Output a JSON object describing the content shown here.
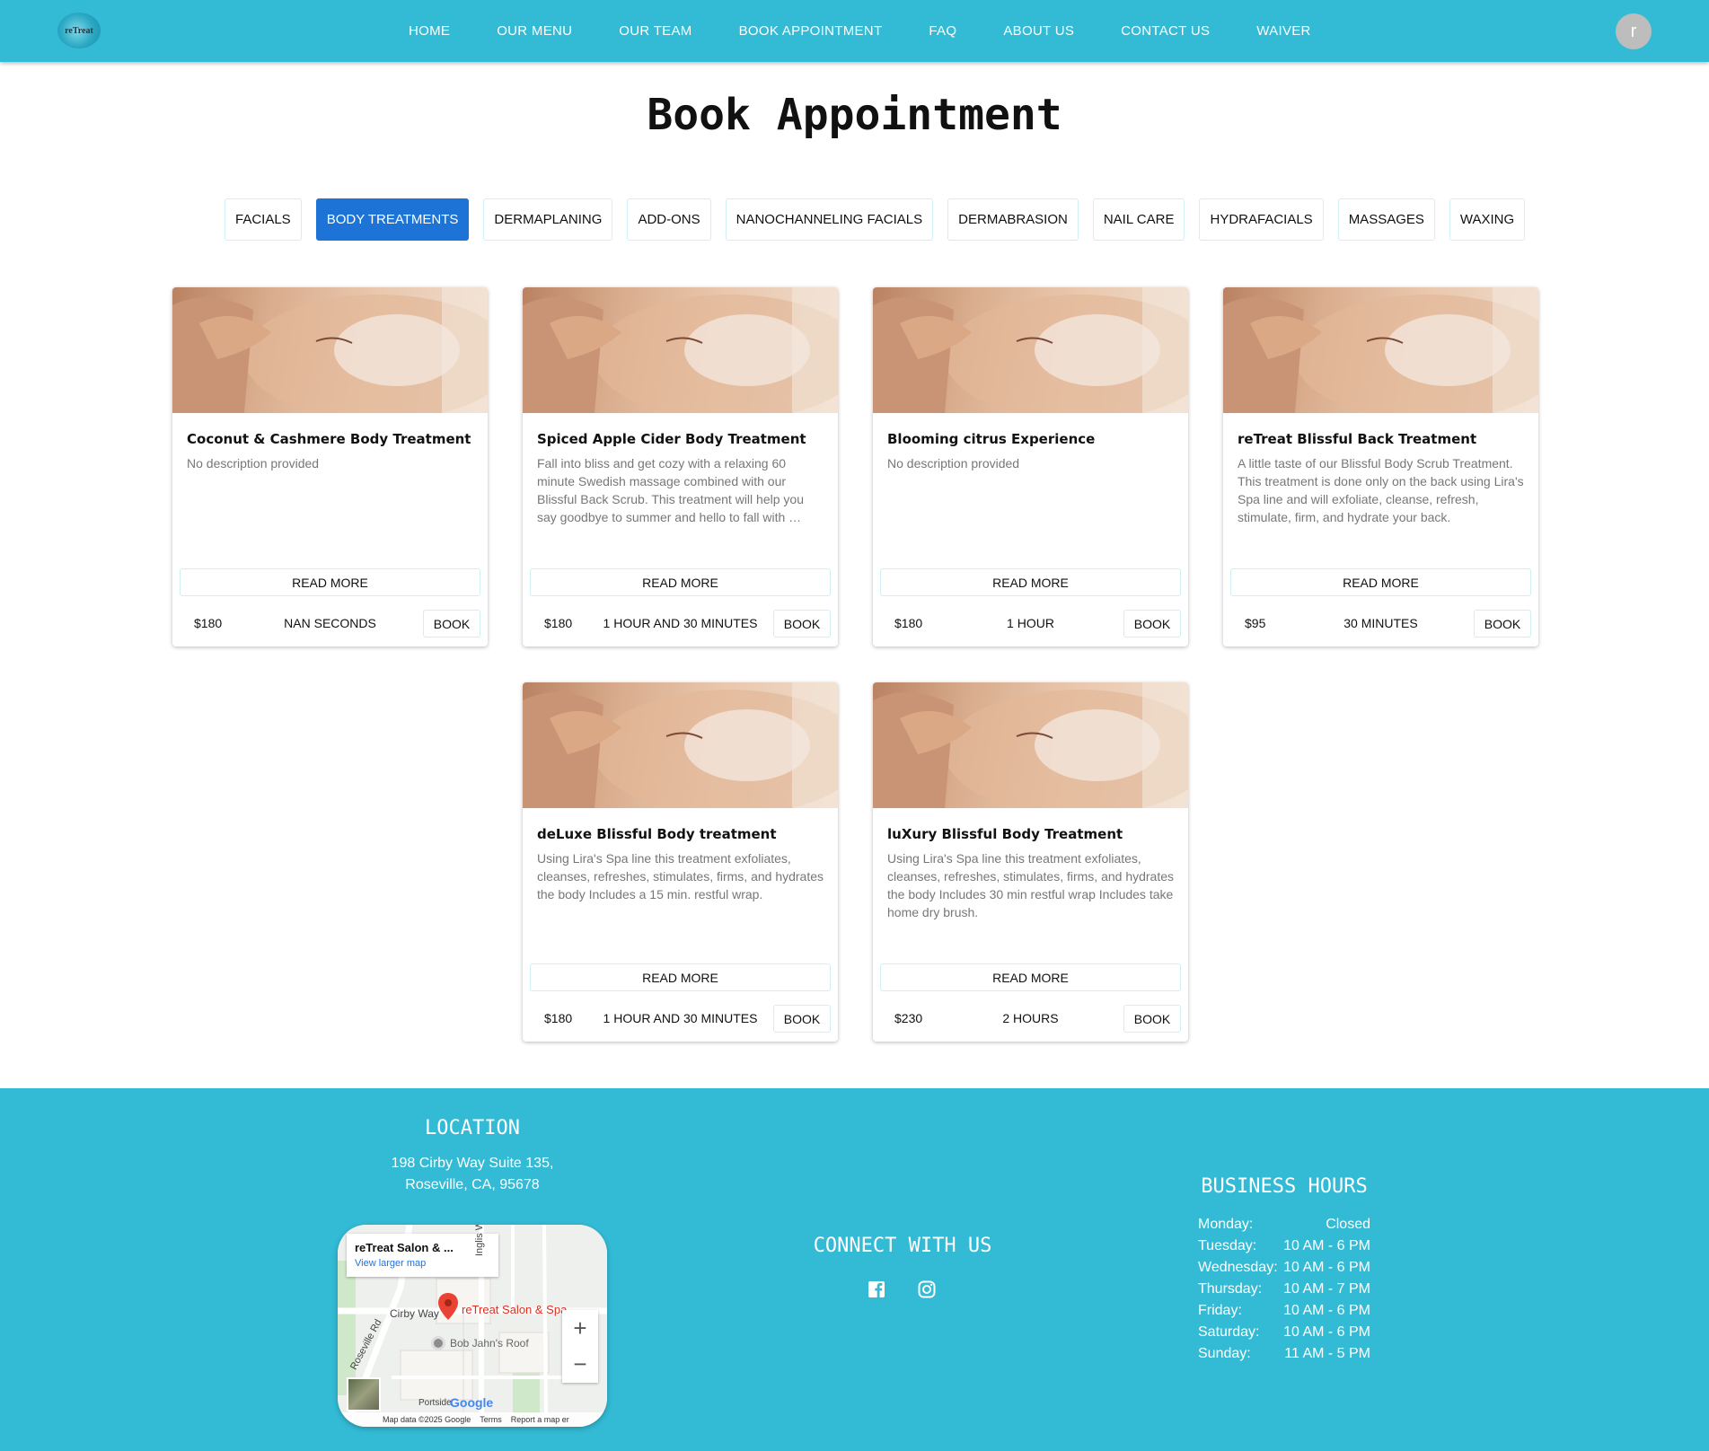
{
  "nav": {
    "logo_text": "reTreat",
    "links": [
      "Home",
      "Our Menu",
      "Our Team",
      "Book Appointment",
      "FAQ",
      "About Us",
      "Contact Us",
      "Waiver"
    ],
    "avatar_letter": "r"
  },
  "page": {
    "title": "Book Appointment"
  },
  "tabs": [
    {
      "label": "Facials",
      "active": false
    },
    {
      "label": "Body Treatments",
      "active": true
    },
    {
      "label": "Dermaplaning",
      "active": false
    },
    {
      "label": "Add-ons",
      "active": false
    },
    {
      "label": "Nanochanneling Facials",
      "active": false
    },
    {
      "label": "Dermabrasion",
      "active": false
    },
    {
      "label": "Nail Care",
      "active": false
    },
    {
      "label": "Hydrafacials",
      "active": false
    },
    {
      "label": "Massages",
      "active": false
    },
    {
      "label": "Waxing",
      "active": false
    }
  ],
  "cards": [
    {
      "title": "Coconut & Cashmere Body Treatment",
      "description": "No description provided",
      "read_more": "Read More",
      "price": "$180",
      "duration": "NaN Seconds",
      "book": "Book"
    },
    {
      "title": "Spiced Apple Cider Body Treatment",
      "description": "Fall into bliss and get cozy with a relaxing 60 minute Swedish massage combined with our Blissful Back Scrub. This treatment will help you say goodbye to summer and hello to fall with …",
      "read_more": "Read More",
      "price": "$180",
      "duration": "1 Hour and 30 Minutes",
      "book": "Book"
    },
    {
      "title": "Blooming citrus Experience",
      "description": "No description provided",
      "read_more": "Read More",
      "price": "$180",
      "duration": "1 Hour",
      "book": "Book"
    },
    {
      "title": "reTreat Blissful Back Treatment",
      "description": "A little taste of our Blissful Body Scrub Treatment. This treatment is done only on the back using Lira's Spa line and will exfoliate, cleanse, refresh, stimulate, firm, and hydrate your back.",
      "read_more": "Read More",
      "price": "$95",
      "duration": "30 Minutes",
      "book": "Book"
    },
    {
      "title": "deLuxe Blissful Body treatment",
      "description": "Using Lira's Spa line this treatment exfoliates, cleanses, refreshes, stimulates, firms, and hydrates the body Includes a 15 min. restful wrap.",
      "read_more": "Read More",
      "price": "$180",
      "duration": "1 Hour and 30 Minutes",
      "book": "Book"
    },
    {
      "title": "luXury Blissful Body Treatment",
      "description": "Using Lira's Spa line this treatment exfoliates, cleanses, refreshes, stimulates, firms, and hydrates the body Includes 30 min restful wrap Includes take home dry brush.",
      "read_more": "Read More",
      "price": "$230",
      "duration": "2 Hours",
      "book": "Book"
    }
  ],
  "footer": {
    "location_heading": "LOCATION",
    "address_line1": "198 Cirby Way Suite 135,",
    "address_line2": "Roseville, CA, 95678",
    "map": {
      "place_title": "reTreat Salon & ...",
      "view_larger": "View larger map",
      "pin_label": "reTreat Salon & Spa",
      "street_cirby": "Cirby Way",
      "street_roseville": "Roseville Rd",
      "street_inglis": "Inglis Way",
      "poi_bob": "Bob Jahn's Roof",
      "poi_portside": "Portside",
      "google": "Google",
      "map_data": "Map data ©2025 Google",
      "terms": "Terms",
      "report": "Report a map er",
      "zoom_in": "+",
      "zoom_out": "−"
    },
    "connect_heading": "CONNECT WITH US",
    "social_icons": [
      "facebook-icon",
      "instagram-icon"
    ],
    "hours_heading": "BUSINESS HOURS",
    "hours": [
      {
        "day": "Monday:",
        "time": "Closed"
      },
      {
        "day": "Tuesday:",
        "time": "10 AM - 6 PM"
      },
      {
        "day": "Wednesday:",
        "time": "10 AM - 6 PM"
      },
      {
        "day": "Thursday:",
        "time": "10 AM - 7 PM"
      },
      {
        "day": "Friday:",
        "time": "10 AM - 6 PM"
      },
      {
        "day": "Saturday:",
        "time": "10 AM - 6 PM"
      },
      {
        "day": "Sunday:",
        "time": "11 AM - 5 PM"
      }
    ]
  },
  "colors": {
    "brand": "#33bad4",
    "active_tab": "#1e73d6",
    "map_pin": "#ea4335"
  }
}
